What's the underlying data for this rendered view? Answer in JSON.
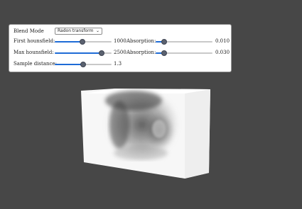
{
  "controls": {
    "blend_mode": {
      "label": "Blend Mode",
      "value": "Radon transform"
    },
    "first_hounsfield": {
      "label": "First hounsfield:",
      "value": "1000",
      "fraction": 0.49
    },
    "absorption_1": {
      "label": "Absorption:",
      "value": "0.010",
      "fraction": 0.15
    },
    "max_hounsfield": {
      "label": "Max hounsfield:",
      "value": "2500",
      "fraction": 0.82
    },
    "absorption_2": {
      "label": "Absorption:",
      "value": "0.030",
      "fraction": 0.15
    },
    "sample_distance": {
      "label": "Sample distance:",
      "value": "1.3",
      "fraction": 0.5
    }
  },
  "colors": {
    "background": "#474747",
    "slider_fill": "#1e6bd6",
    "slider_thumb": "#5b6270"
  }
}
